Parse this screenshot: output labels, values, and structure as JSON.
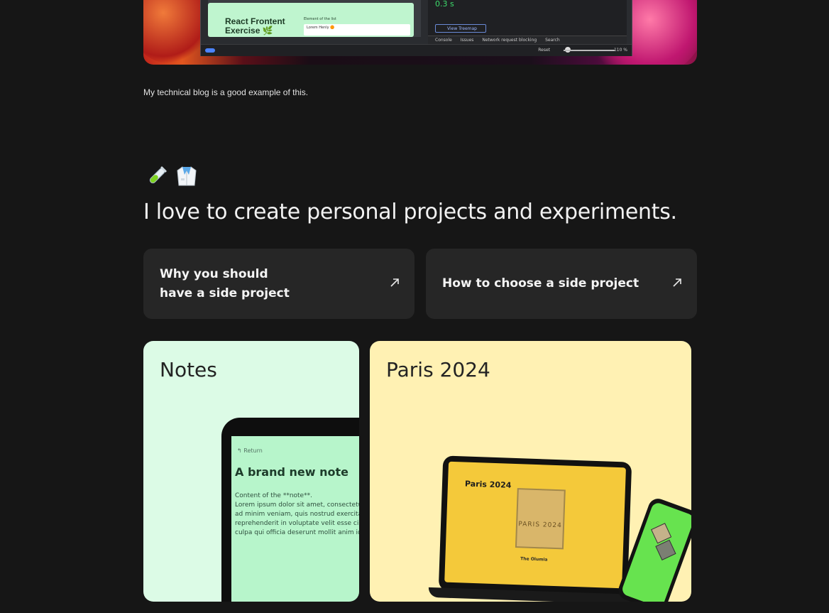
{
  "hero_screenshot": {
    "card_title": "React Frontent\nExercise 🌿",
    "list_label": "Element of the list",
    "list_item": "Lorem Henly 🟠",
    "timer": "0.3 s",
    "treemap_label": "View Treemap",
    "devtools_tabs": [
      "Console",
      "Issues",
      "Network request blocking",
      "Search"
    ],
    "reset_label": "Reset",
    "zoom_level": "110 %"
  },
  "blog_line": "My technical blog is a good example of this.",
  "icons": [
    "test-tube-icon",
    "lab-coat-icon"
  ],
  "headline": "I love to create personal projects and experiments.",
  "link_cards": [
    {
      "label": "Why you should\nhave a side project",
      "icon": "arrow-up-right-icon"
    },
    {
      "label": "How to choose a side project",
      "icon": "arrow-up-right-icon"
    }
  ],
  "projects": [
    {
      "title": "Notes",
      "color": "#dcfbe6",
      "device": {
        "return_label": "↰ Return",
        "note_title": "A brand new note",
        "note_body": "Content of the **note**.\nLorem ipsum dolor sit amet, consecteturr\nad minim veniam, quis nostrud exercitat\nreprehenderit in voluptate velit esse cil\nculpa qui officia deserunt mollit anim id"
      }
    },
    {
      "title": "Paris 2024",
      "color": "#fff1b3",
      "device": {
        "site_title": "Paris 2024",
        "book_title": "PARIS 2024",
        "book_caption": "The Olumia"
      }
    }
  ]
}
